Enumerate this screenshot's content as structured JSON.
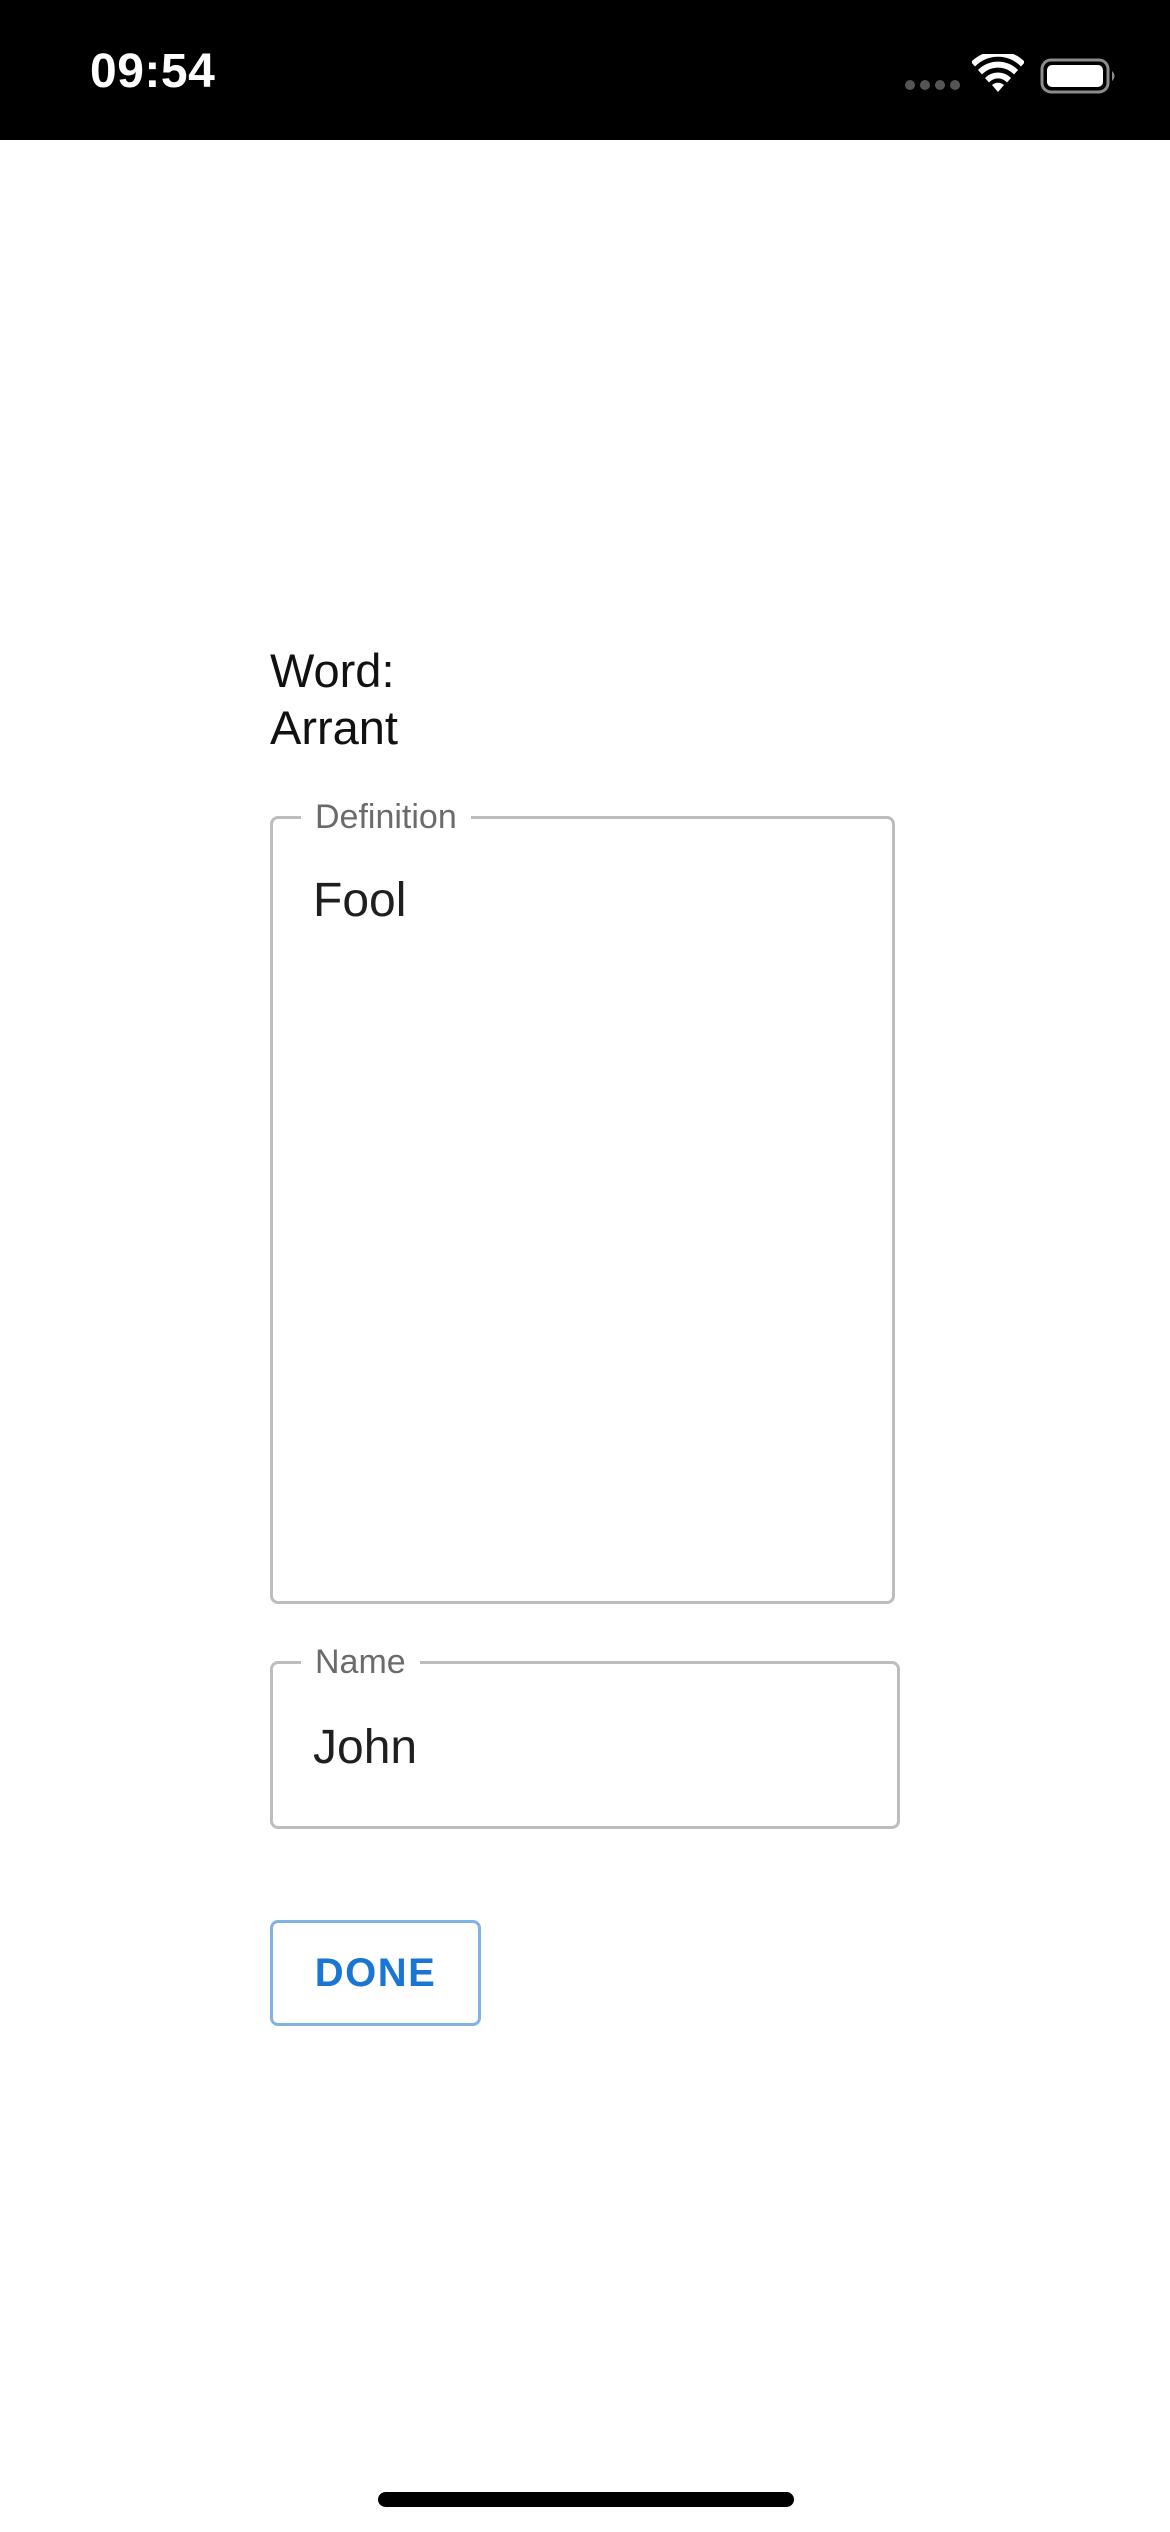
{
  "status_bar": {
    "time": "09:54",
    "icons": [
      "cellular-signal-icon",
      "wifi-icon",
      "battery-icon"
    ]
  },
  "word": {
    "label": "Word:",
    "value": "Arrant"
  },
  "definition_field": {
    "legend": "Definition",
    "value": "Fool"
  },
  "name_field": {
    "legend": "Name",
    "value": "John"
  },
  "done_button": {
    "label": "DONE"
  },
  "colors": {
    "status_bar_bg": "#000000",
    "accent": "#1976d2",
    "field_border": "#bdbdbd",
    "legend_text": "#6b6b6b"
  }
}
